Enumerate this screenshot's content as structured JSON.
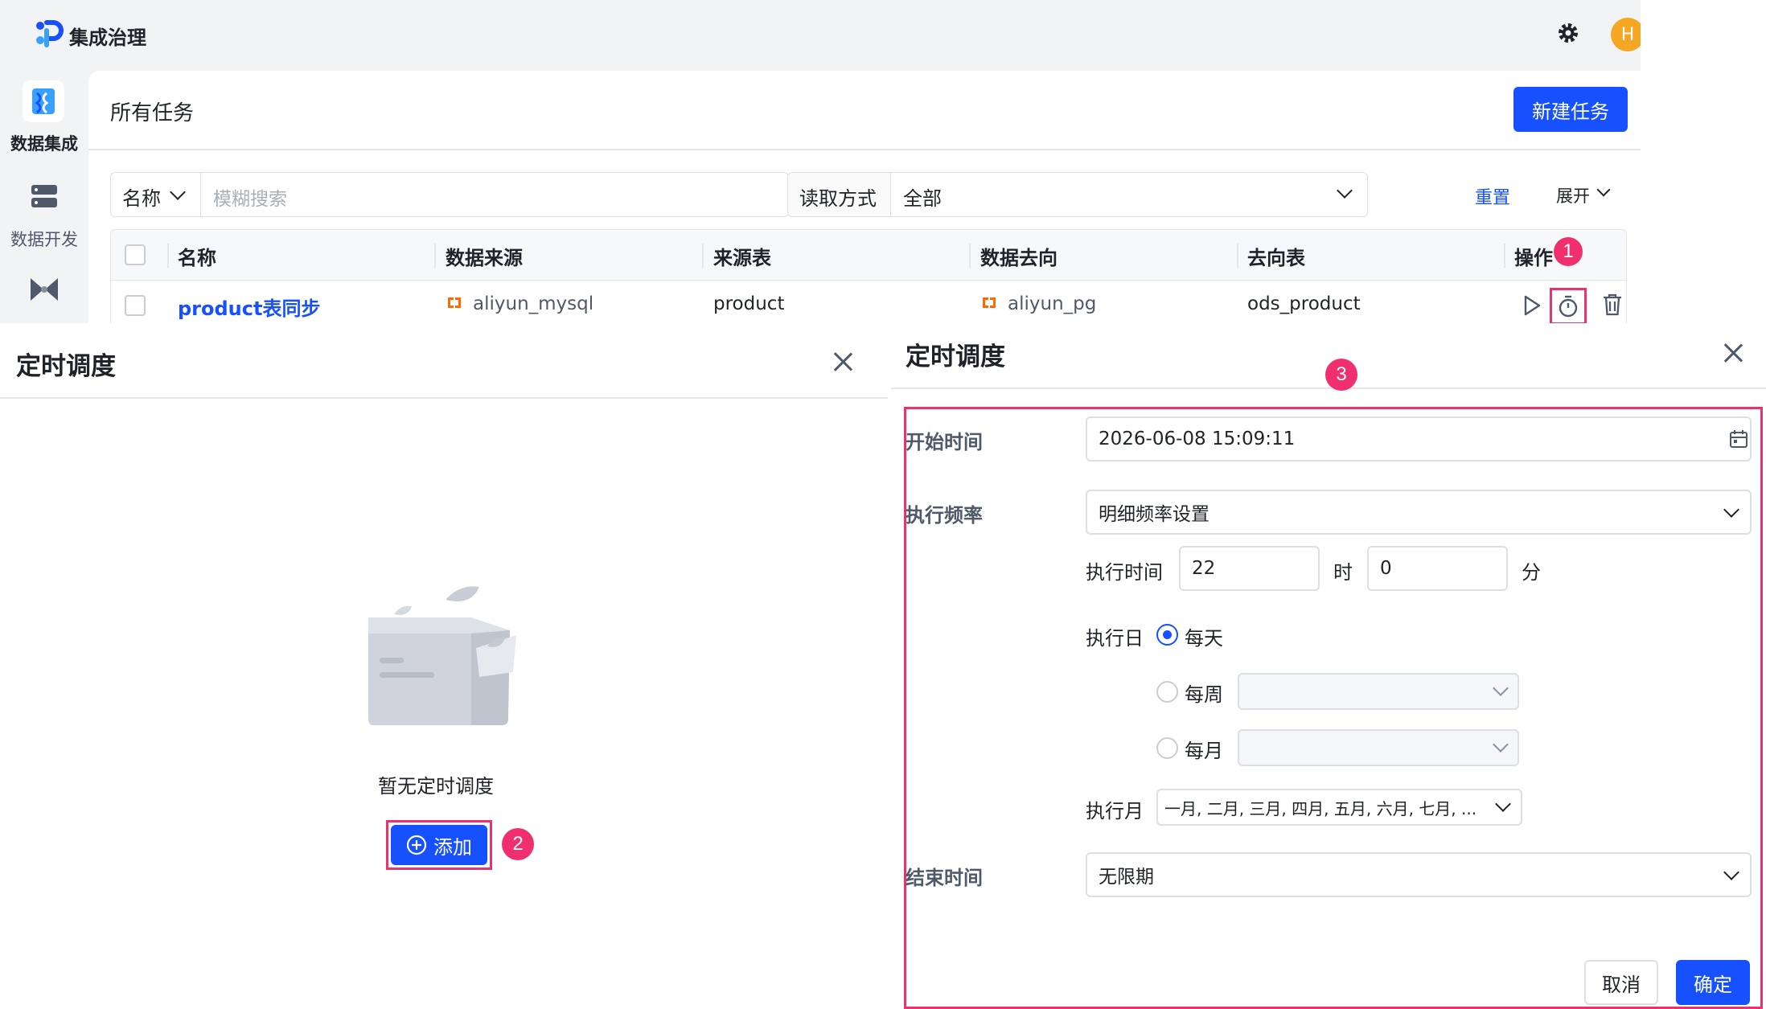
{
  "app": {
    "title": "集成治理",
    "avatar_initial": "H"
  },
  "sidebar": {
    "items": [
      {
        "label": "数据集成"
      },
      {
        "label": "数据开发"
      }
    ]
  },
  "page": {
    "title": "所有任务",
    "new_task_button": "新建任务"
  },
  "filters": {
    "field_select": "名称",
    "search_placeholder": "模糊搜索",
    "read_mode_label": "读取方式",
    "read_mode_value": "全部",
    "reset": "重置",
    "expand": "展开"
  },
  "table": {
    "headers": [
      "名称",
      "数据来源",
      "来源表",
      "数据去向",
      "去向表",
      "操作"
    ],
    "rows": [
      {
        "name": "product表同步",
        "source": "aliyun_mysql",
        "source_table": "product",
        "target": "aliyun_pg",
        "target_table": "ods_product"
      }
    ]
  },
  "schedule_empty_dialog": {
    "title": "定时调度",
    "empty_text": "暂无定时调度",
    "add_button": "添加"
  },
  "schedule_form_dialog": {
    "title": "定时调度",
    "start_time_label": "开始时间",
    "start_time_value": "2026-06-08 15:09:11",
    "frequency_label": "执行频率",
    "frequency_value": "明细频率设置",
    "exec_time_label": "执行时间",
    "hour_value": "22",
    "hour_unit": "时",
    "minute_value": "0",
    "minute_unit": "分",
    "exec_day_label": "执行日",
    "day_options": [
      "每天",
      "每周",
      "每月"
    ],
    "selected_day_option": "每天",
    "exec_month_label": "执行月",
    "exec_month_value": "一月, 二月, 三月, 四月, 五月, 六月, 七月, ...",
    "end_time_label": "结束时间",
    "end_time_value": "无限期",
    "cancel_button": "取消",
    "confirm_button": "确定"
  },
  "annotations": [
    "1",
    "2",
    "3"
  ],
  "colors": {
    "primary": "#1650ff",
    "annotation": "#e8336e",
    "link": "#1650ff"
  }
}
